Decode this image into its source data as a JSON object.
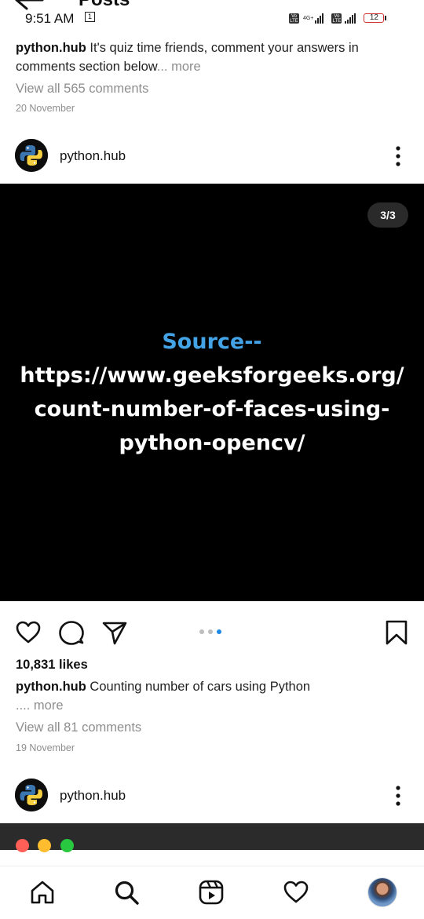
{
  "status_bar": {
    "time": "9:51 AM",
    "calendar_day": "1",
    "volte": "Vo LTE",
    "net_type": "4G+",
    "battery": "12"
  },
  "header": {
    "title": "Posts"
  },
  "prev_post": {
    "username": "python.hub",
    "caption": " It's quiz time friends, comment your answers in comments section below",
    "more": "... more",
    "view_comments": "View all 565 comments",
    "date": "20 November"
  },
  "post": {
    "username": "python.hub",
    "image": {
      "counter": "3/3",
      "line1": "Source--",
      "line2": "https://www.geeksforgeeks.org/",
      "line3": "count-number-of-faces-using-",
      "line4": "python-opencv/"
    },
    "carousel": {
      "count": 3,
      "active_index": 3
    },
    "likes": "10,831 likes",
    "caption": " Counting number of cars using Python",
    "more": ".... more",
    "view_comments": "View all 81 comments",
    "date": "19 November"
  },
  "next_post": {
    "username": "python.hub"
  },
  "colors": {
    "link_blue": "#43a3e6",
    "carousel_active": "#1e88e5",
    "muted": "#8e8e8e",
    "traffic_red": "#ff5f57",
    "traffic_yellow": "#febc2e",
    "traffic_green": "#28c840"
  },
  "nav": {
    "items": [
      "home-icon",
      "search-icon",
      "reels-icon",
      "heart-icon",
      "profile-avatar"
    ]
  }
}
